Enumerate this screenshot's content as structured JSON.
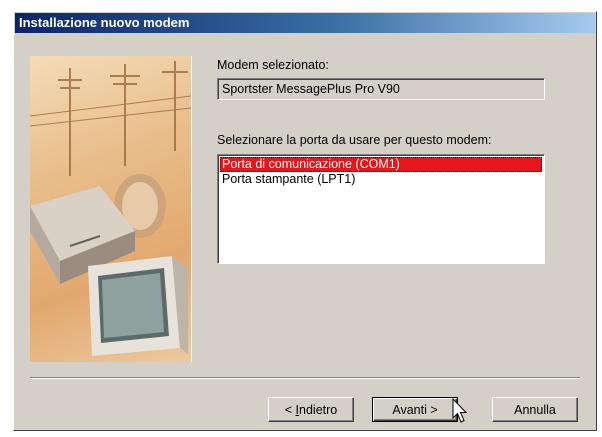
{
  "window": {
    "title": "Installazione nuovo modem"
  },
  "modem": {
    "label": "Modem selezionato:",
    "value": "Sportster MessagePlus Pro V90"
  },
  "port": {
    "label": "Selezionare la porta da usare per questo modem:",
    "items": [
      {
        "label": "Porta di comunicazione (COM1)",
        "selected": true
      },
      {
        "label": "Porta stampante (LPT1)",
        "selected": false
      }
    ]
  },
  "buttons": {
    "back_prefix": "< ",
    "back_accel": "I",
    "back_rest": "ndietro",
    "next_label": "Avanti >",
    "cancel_label": "Annulla"
  },
  "colors": {
    "titlebar_start": "#0a246a",
    "selection": "#e8161b",
    "dialog_bg": "#d4d0c8"
  }
}
